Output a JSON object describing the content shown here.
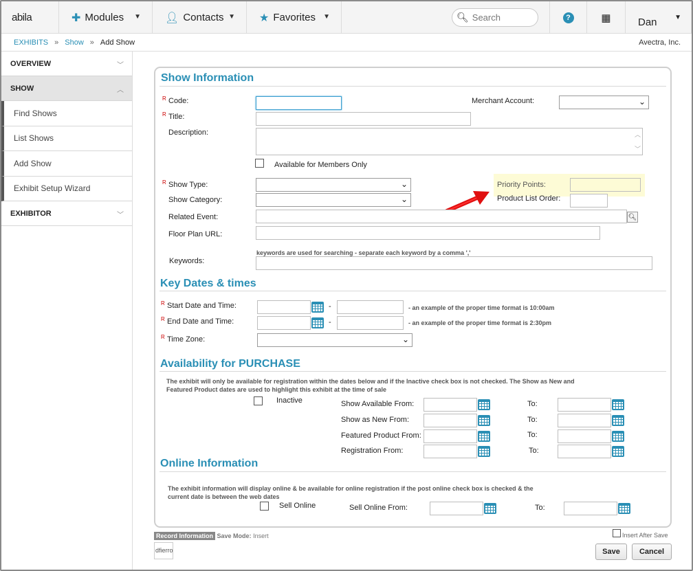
{
  "app": {
    "logo": "abila",
    "logo_dot": "."
  },
  "nav": {
    "modules": "Modules",
    "contacts": "Contacts",
    "favorites": "Favorites",
    "search_placeholder": "Search",
    "help": "?",
    "user": "Dan"
  },
  "breadcrumb": {
    "items": [
      "EXHIBITS",
      "Show",
      "Add Show"
    ],
    "sep": "»",
    "company": "Avectra, Inc."
  },
  "sidebar": {
    "overview": "OVERVIEW",
    "show": "SHOW",
    "items": [
      "Find Shows",
      "List Shows",
      "Add Show",
      "Exhibit Setup Wizard"
    ],
    "exhibitor": "EXHIBITOR"
  },
  "show_info": {
    "title": "Show Information",
    "req": "R",
    "code": "Code:",
    "title_lbl": "Title:",
    "description": "Description:",
    "members_only": "Available for Members Only",
    "merchant_account": "Merchant Account:",
    "show_type": "Show Type:",
    "show_category": "Show Category:",
    "related_event": "Related Event:",
    "floor_plan_url": "Floor Plan URL:",
    "keywords": "Keywords:",
    "keywords_note": "keywords are used for searching - separate each keyword by a comma ','",
    "priority_points": "Priority Points:",
    "product_list_order": "Product List Order:"
  },
  "key_dates": {
    "title": "Key Dates & times",
    "start": "Start Date and Time:",
    "end": "End Date and Time:",
    "time_zone": "Time Zone:",
    "dash": "-",
    "start_note": "- an example of the proper time format is 10:00am",
    "end_note": "- an example of the proper time format is 2:30pm"
  },
  "availability": {
    "title": "Availability for PURCHASE",
    "note": "The exhibit will only be available for registration within the dates below and if the Inactive check box is not checked. The Show as New and Featured Product dates are used to highlight this exhibit at the time of sale",
    "inactive": "Inactive",
    "rows": [
      "Show Available From:",
      "Show as New From:",
      "Featured Product From:",
      "Registration From:"
    ],
    "to": "To:"
  },
  "online": {
    "title": "Online Information",
    "note": "The exhibit information will display online & be available for online registration if the post online check box is checked & the current date is between the web dates",
    "sell_online": "Sell Online",
    "sell_online_from": "Sell Online From:",
    "to": "To:"
  },
  "footer": {
    "record_info": "Record Information",
    "save_mode_label": "Save Mode:",
    "save_mode": "Insert",
    "user": "dfierro",
    "insert_after_save": "Insert After Save",
    "save": "Save",
    "cancel": "Cancel"
  },
  "colors": {
    "accent": "#2a8fb5",
    "highlight": "#fdfbd6",
    "arrow": "#e01010"
  }
}
